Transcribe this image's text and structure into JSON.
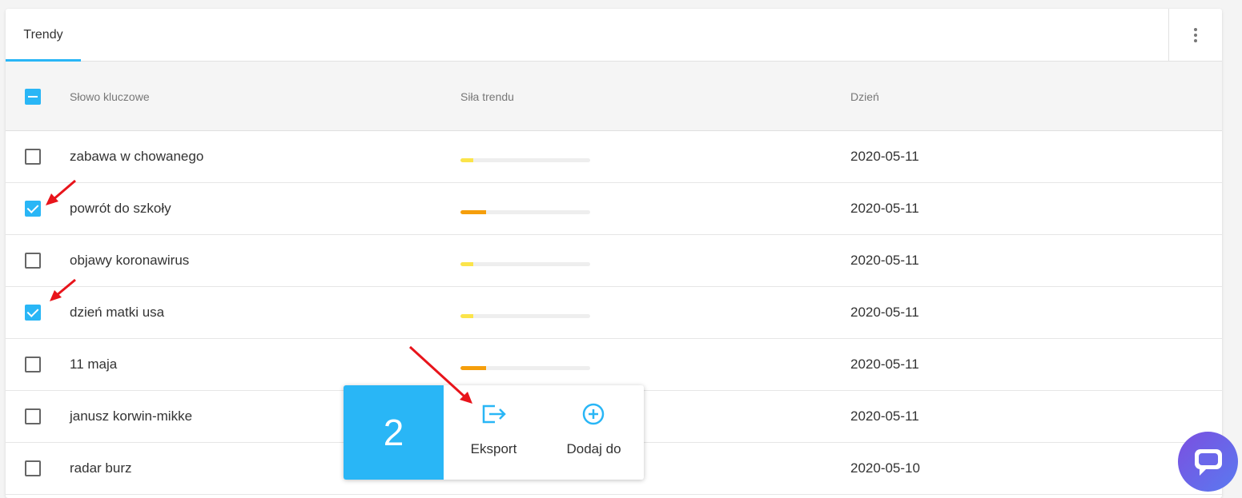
{
  "tab": {
    "label": "Trendy"
  },
  "table": {
    "columns": [
      "Słowo kluczowe",
      "Siła trendu",
      "Dzień"
    ],
    "rows": [
      {
        "keyword": "zabawa w chowanego",
        "strength": 0.1,
        "strength_color": "#fbe44a",
        "date": "2020-05-11",
        "checked": false
      },
      {
        "keyword": "powrót do szkoły",
        "strength": 0.2,
        "strength_color": "#f59e0b",
        "date": "2020-05-11",
        "checked": true
      },
      {
        "keyword": "objawy koronawirus",
        "strength": 0.1,
        "strength_color": "#fbe44a",
        "date": "2020-05-11",
        "checked": false
      },
      {
        "keyword": "dzień matki usa",
        "strength": 0.1,
        "strength_color": "#fbe44a",
        "date": "2020-05-11",
        "checked": true
      },
      {
        "keyword": "11 maja",
        "strength": 0.2,
        "strength_color": "#f59e0b",
        "date": "2020-05-11",
        "checked": false
      },
      {
        "keyword": "janusz korwin-mikke",
        "strength": null,
        "strength_color": "#fbe44a",
        "date": "2020-05-11",
        "checked": false
      },
      {
        "keyword": "radar burz",
        "strength": null,
        "strength_color": "#fbe44a",
        "date": "2020-05-10",
        "checked": false
      }
    ]
  },
  "selection": {
    "count": "2",
    "export_label": "Eksport",
    "add_label": "Dodaj do"
  },
  "colors": {
    "accent": "#29b6f6",
    "arrow": "#e8141b"
  }
}
